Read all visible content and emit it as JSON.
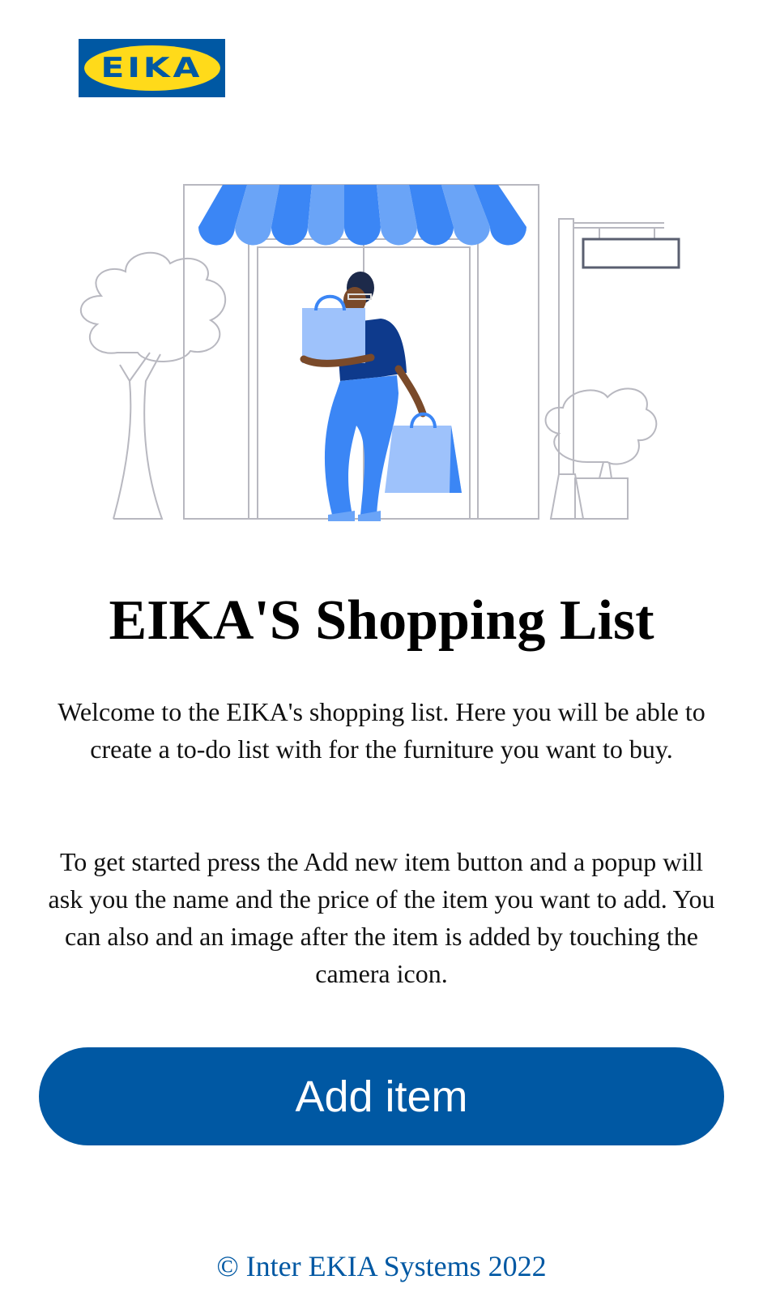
{
  "brand": {
    "logo_text": "EIKA",
    "registered_mark": "®",
    "colors": {
      "blue": "#0058a3",
      "yellow": "#ffda1a"
    }
  },
  "illustration": {
    "icon": "shopping-woman-storefront-illustration"
  },
  "main": {
    "title": "EIKA'S Shopping List",
    "paragraph_1": "Welcome to the EIKA's shopping list. Here you will be able to create a to-do list with for the furniture you want to buy.",
    "paragraph_2": "To get started press the Add new item button and a popup will ask you the name and the price of the item you want to add. You can also and an image after the item is added by touching the camera icon."
  },
  "actions": {
    "add_item_label": "Add item"
  },
  "footer": {
    "text": "© Inter EKIA Systems 2022"
  }
}
